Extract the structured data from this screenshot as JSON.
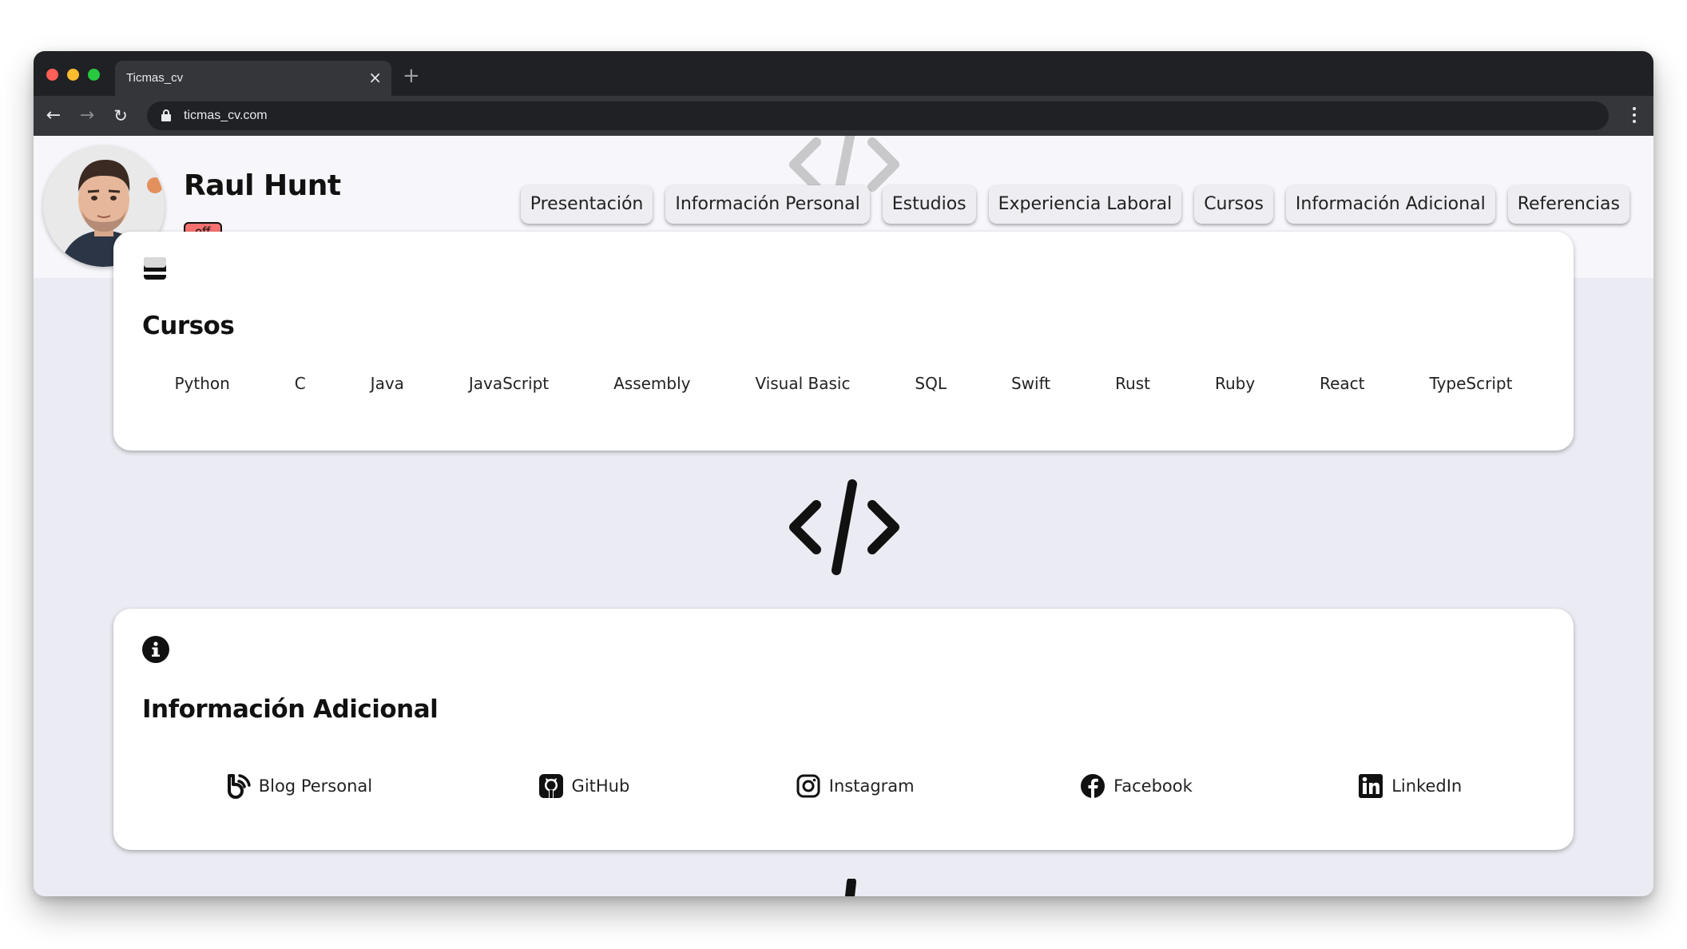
{
  "browser": {
    "tab_title": "Ticmas_cv",
    "tab_close": "×",
    "new_tab": "+",
    "url": "ticmas_cv.com"
  },
  "profile": {
    "name": "Raul Hunt",
    "status": "off"
  },
  "nav": {
    "items": [
      "Presentación",
      "Información Personal",
      "Estudios",
      "Experiencia Laboral",
      "Cursos",
      "Información Adicional",
      "Referencias"
    ]
  },
  "cursos": {
    "title": "Cursos",
    "icon": "credit-card-icon",
    "items": [
      "Python",
      "C",
      "Java",
      "JavaScript",
      "Assembly",
      "Visual Basic",
      "SQL",
      "Swift",
      "Rust",
      "Ruby",
      "React",
      "TypeScript"
    ]
  },
  "adicional": {
    "title": "Información Adicional",
    "icon": "info-icon",
    "links": [
      {
        "label": "Blog Personal",
        "icon": "blogger-icon"
      },
      {
        "label": "GitHub",
        "icon": "github-icon"
      },
      {
        "label": "Instagram",
        "icon": "instagram-icon"
      },
      {
        "label": "Facebook",
        "icon": "facebook-icon"
      },
      {
        "label": "LinkedIn",
        "icon": "linkedin-icon"
      }
    ]
  },
  "colors": {
    "badge_off": "#f87171",
    "page_bg": "#ebebf3",
    "chrome_dark": "#202124"
  }
}
